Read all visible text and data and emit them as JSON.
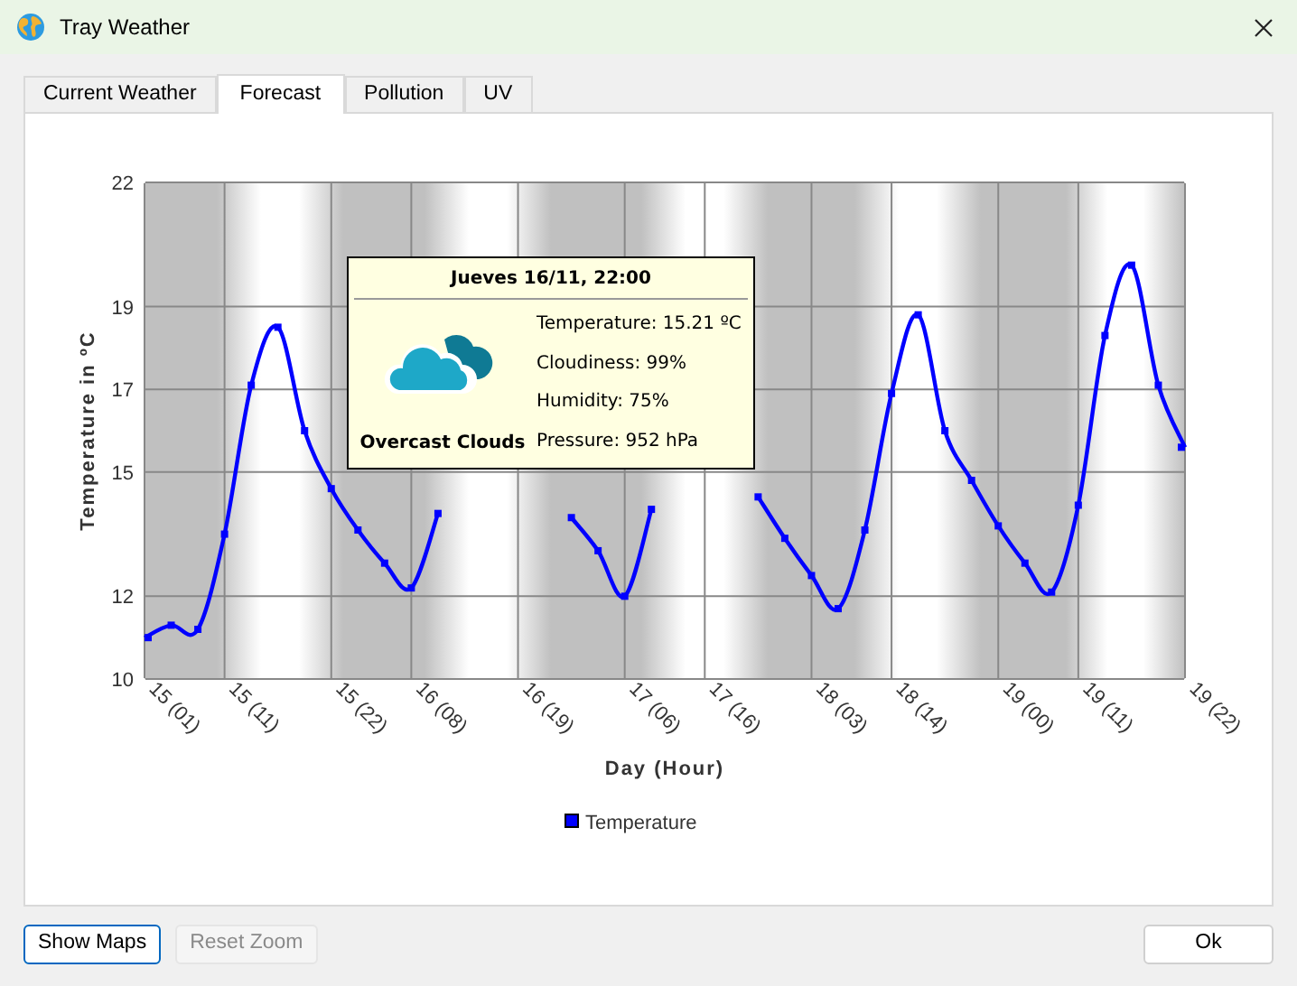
{
  "window": {
    "title": "Tray Weather"
  },
  "tabs": [
    {
      "label": "Current Weather",
      "selected": false
    },
    {
      "label": "Forecast",
      "selected": true
    },
    {
      "label": "Pollution",
      "selected": false
    },
    {
      "label": "UV",
      "selected": false
    }
  ],
  "chart": {
    "chart_data": {
      "type": "line",
      "grid": true,
      "xlabel": "Day (Hour)",
      "ylabel": "Temperature in ºC",
      "ylim": [
        10,
        22
      ],
      "categories": [
        "15 (01)",
        null,
        null,
        "15 (11)",
        null,
        null,
        null,
        "15 (22)",
        null,
        null,
        "16 (08)",
        null,
        null,
        null,
        "16 (19)",
        null,
        null,
        null,
        "17 (06)",
        null,
        null,
        "17 (16)",
        null,
        null,
        null,
        "18 (03)",
        null,
        null,
        "18 (14)",
        null,
        null,
        null,
        "19 (00)",
        null,
        null,
        "19 (11)",
        null,
        null,
        null,
        "19 (22)"
      ],
      "yticks": [
        10,
        12,
        15,
        17,
        19,
        22
      ],
      "series": [
        {
          "name": "Temperature",
          "color": "#0000ff",
          "marker": "square",
          "values": [
            11.0,
            11.3,
            11.2,
            13.5,
            17.1,
            18.5,
            16.0,
            14.6,
            13.6,
            12.8,
            12.2,
            14.0,
            null,
            null,
            null,
            null,
            13.9,
            13.1,
            12.0,
            14.1,
            null,
            null,
            null,
            14.4,
            13.4,
            12.5,
            11.7,
            13.6,
            16.9,
            18.8,
            16.0,
            14.8,
            13.7,
            12.8,
            12.1,
            14.2,
            18.3,
            20.0,
            17.1,
            15.6
          ]
        }
      ]
    },
    "tooltip": {
      "title": "Jueves 16/11, 22:00",
      "condition": "Overcast Clouds",
      "lines": [
        "Temperature: 15.21 ºC",
        "Cloudiness: 99%",
        "Humidity: 75%",
        "Pressure: 952 hPa"
      ]
    }
  },
  "buttons": [
    {
      "label": "Show Maps",
      "disabled": false
    },
    {
      "label": "Reset Zoom",
      "disabled": true
    },
    {
      "label": "Ok",
      "disabled": false
    }
  ]
}
